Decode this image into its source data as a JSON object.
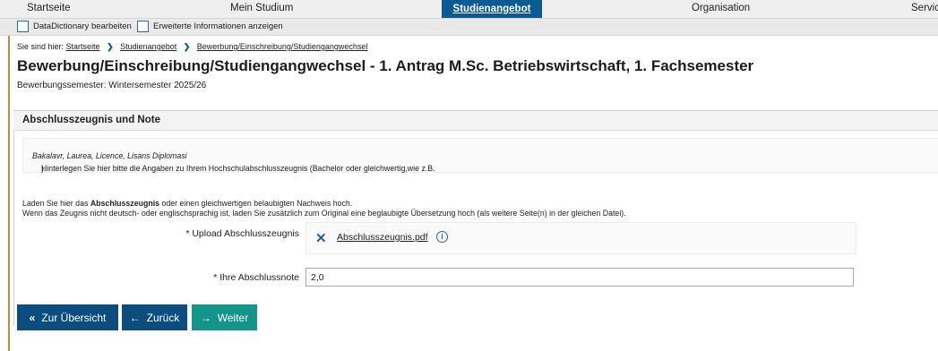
{
  "nav": {
    "items": [
      "Startseite",
      "Mein Studium",
      "Studienangebot",
      "Organisation",
      "Servic"
    ],
    "active": "Studienangebot"
  },
  "subbar": {
    "datadictionary": "DataDictionary bearbeiten",
    "extended_info": "Erweiterte Informationen anzeigen"
  },
  "breadcrumb": {
    "prefix": "Sie sind hier:",
    "items": [
      "Startseite",
      "Studienangebot",
      "Bewerbung/Einschreibung/Studiengangwechsel"
    ]
  },
  "page": {
    "title": "Bewerbung/Einschreibung/Studiengangwechsel - 1. Antrag M.Sc. Betriebswirtschaft, 1. Fachsemester",
    "semester": "Bewerbungssemester: Wintersemester 2025/26"
  },
  "panel": {
    "heading": "Abschlusszeugnis und Note",
    "hint_before": "Hinterlegen Sie hier bitte die Angaben zu Ihrem Hochschulabschlusszeugnis (Bachelor oder gleichwertig,wie z.B. ",
    "hint_examples": "Bakalavr, Laurea, Licence, Lisans Diplomasi",
    "hint_after": ").",
    "instr1_before": "Laden Sie hier das ",
    "instr1_bold": "Abschlusszeugnis",
    "instr1_after": " oder einen gleichwertigen belaubigten Nachweis hoch.",
    "instr2": "Wenn das Zeugnis nicht deutsch- oder englischsprachig ist, laden Sie zusätzlich zum Original eine beglaubigte Übersetzung hoch (als weitere Seite(n) in der gleichen Datei).",
    "upload_label": "* Upload Abschlusszeugnis",
    "upload_file": "Abschlusszeugnis.pdf",
    "grade_label": "* Ihre Abschlussnote",
    "grade_value": "2,0"
  },
  "buttons": {
    "overview": "Zur Übersicht",
    "back": "Zurück",
    "next": "Weiter"
  },
  "colors": {
    "nav_active": "#0a5a96",
    "button_dark": "#0b4d7e",
    "button_green": "#14958b"
  },
  "icons": {
    "overview": "double-chevron-left-icon",
    "back": "arrow-left-icon",
    "next": "arrow-right-icon",
    "remove": "close-icon",
    "info": "info-icon"
  }
}
